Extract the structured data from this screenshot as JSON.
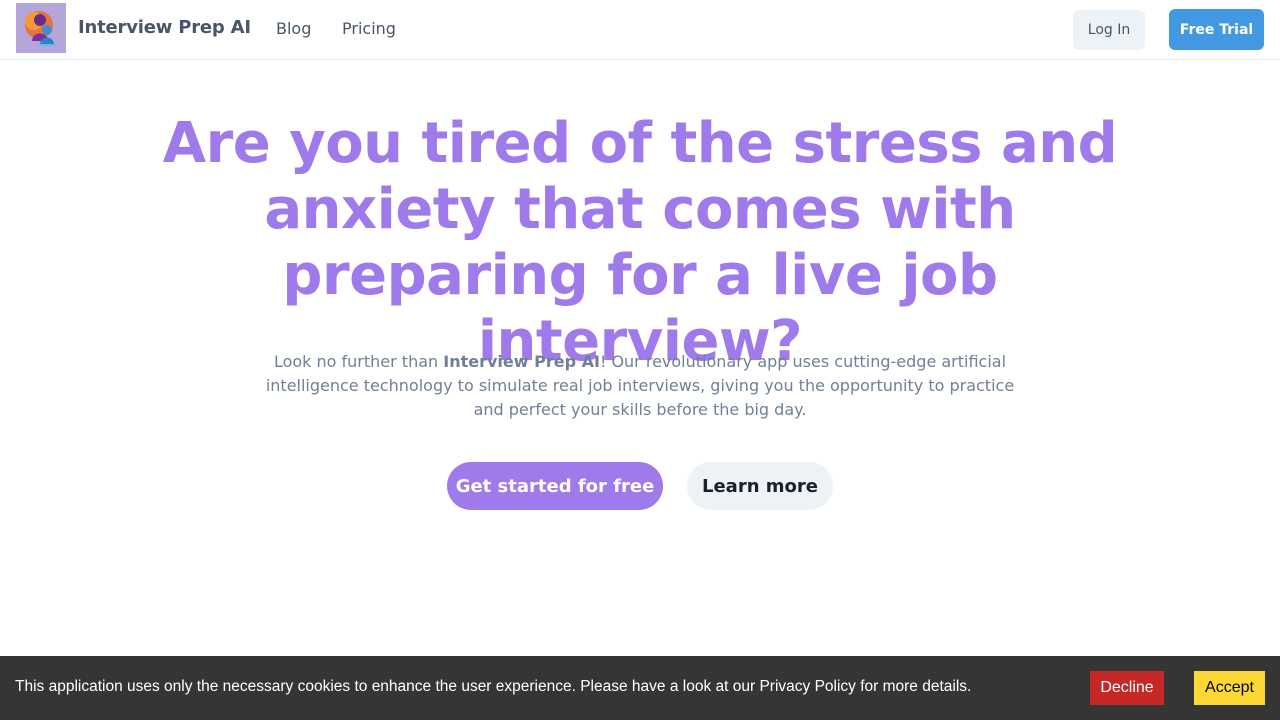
{
  "header": {
    "logo_icon": "people-silhouette-logo",
    "brand": "Interview Prep AI",
    "nav": [
      {
        "label": "Blog"
      },
      {
        "label": "Pricing"
      }
    ],
    "login_label": "Log In",
    "trial_label": "Free Trial"
  },
  "hero": {
    "title": "Are you tired of the stress and anxiety that comes with preparing for a live job interview?",
    "desc_before": "Look no further than ",
    "desc_brand": "Interview Prep AI",
    "desc_after": "! Our revolutionary app uses cutting-edge artificial intelligence technology to simulate real job interviews, giving you the opportunity to practice and perfect your skills before the big day.",
    "primary_cta": "Get started for free",
    "secondary_cta": "Learn more"
  },
  "cookie": {
    "message": "This application uses only the necessary cookies to enhance the user experience. Please have a look at our Privacy Policy for more details.",
    "decline_label": "Decline",
    "accept_label": "Accept"
  },
  "colors": {
    "accent": "#9f7aea",
    "trial_button": "#4299e1",
    "decline_button": "#c62828",
    "accept_button": "#fdd835",
    "banner_bg": "#353535"
  }
}
